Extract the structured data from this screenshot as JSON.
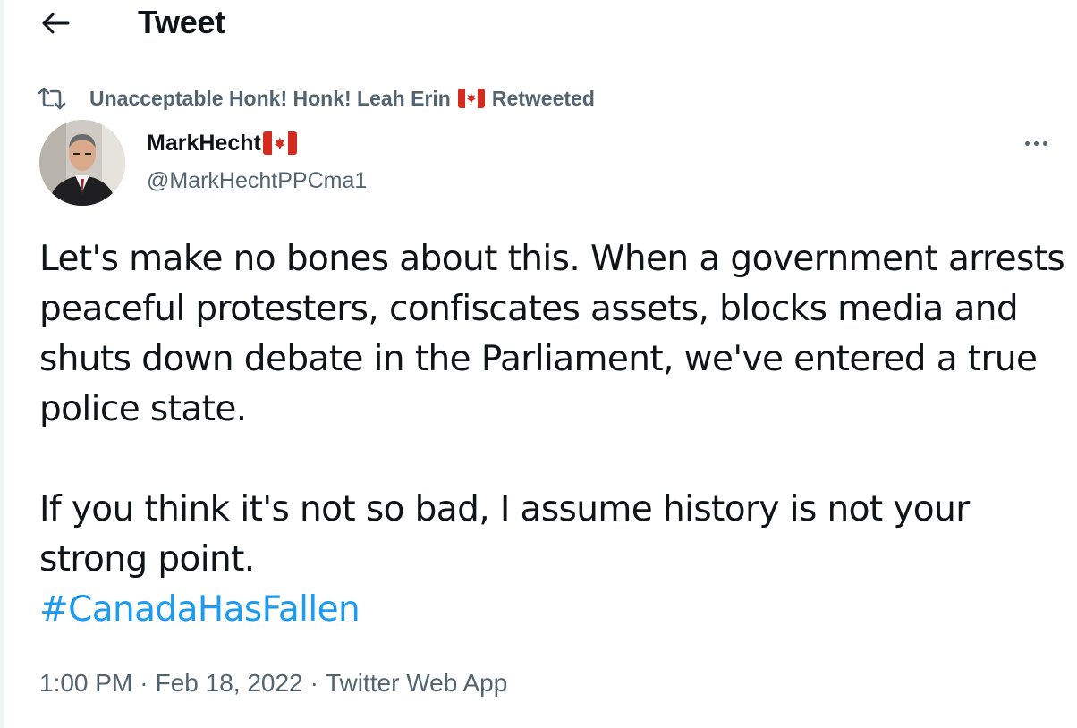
{
  "header": {
    "title": "Tweet",
    "back_icon": "arrow-left-icon"
  },
  "social_context": {
    "icon": "retweet-icon",
    "retweeter_name": "Unacceptable Honk! Honk! Leah Erin",
    "retweeter_flag": "canada-flag-icon",
    "action": "Retweeted"
  },
  "author": {
    "display_name": "MarkHecht",
    "name_flag": "canada-flag-icon",
    "handle": "@MarkHechtPPCma1"
  },
  "tweet": {
    "paragraph_1": "Let's make no bones about this. When a government arrests peaceful protesters, confiscates assets, blocks media and shuts down debate in the Parliament, we've entered a true police state.",
    "paragraph_2": "If you think it's not so bad, I assume history is not your strong point.",
    "hashtag": "#CanadaHasFallen"
  },
  "meta": {
    "time": "1:00 PM",
    "separator": "·",
    "date": "Feb 18, 2022",
    "source": "Twitter Web App"
  },
  "colors": {
    "text": "#0f1419",
    "secondary": "#536471",
    "link": "#1d9bf0",
    "flag_red": "#d52b1e"
  }
}
